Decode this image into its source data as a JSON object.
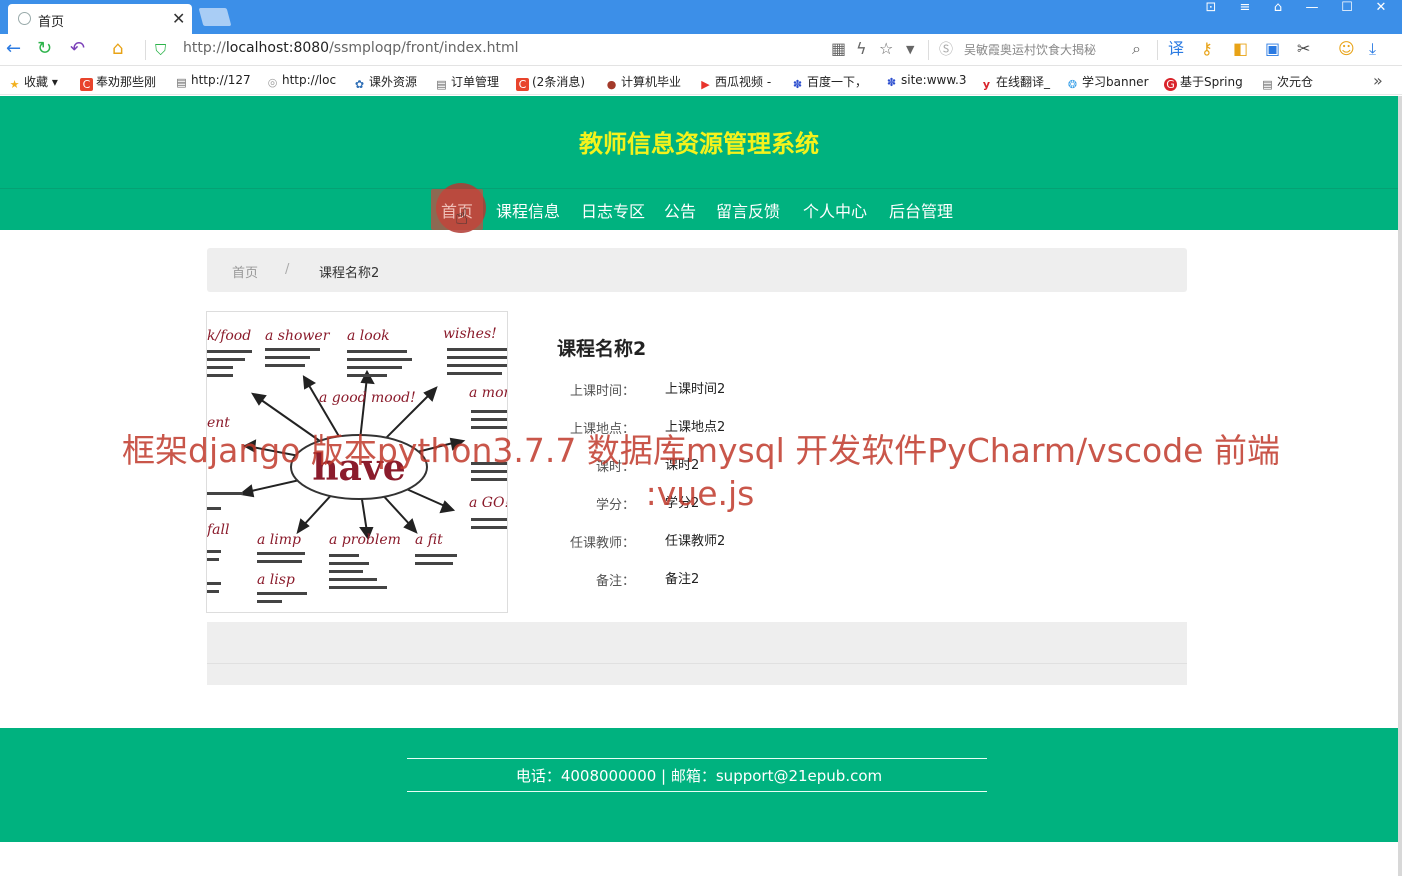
{
  "browser": {
    "tab_title": "首页",
    "url_prefix": "http://",
    "url_host": "localhost:8080",
    "url_path": "/ssmploqp/front/index.html",
    "search_hint": "吴敏霞奥运村饮食大揭秘",
    "bookmarks": [
      {
        "label": "收藏",
        "color": "#f2b01e",
        "icon": "★"
      },
      {
        "label": "奉劝那些刚",
        "color": "#e8442c",
        "icon": "C"
      },
      {
        "label": "http://127",
        "color": "#666666",
        "icon": "▤"
      },
      {
        "label": "http://loc",
        "color": "#999999",
        "icon": "◎"
      },
      {
        "label": "课外资源",
        "color": "#2d6db5",
        "icon": "✿"
      },
      {
        "label": "订单管理",
        "color": "#666666",
        "icon": "▤"
      },
      {
        "label": "(2条消息)",
        "color": "#e8442c",
        "icon": "C"
      },
      {
        "label": "计算机毕业",
        "color": "#a33a2a",
        "icon": "●"
      },
      {
        "label": "西瓜视频 -",
        "color": "#e8342c",
        "icon": "▶"
      },
      {
        "label": "百度一下，",
        "color": "#2d4fcf",
        "icon": "✽"
      },
      {
        "label": "site:www.3",
        "color": "#2d4fcf",
        "icon": "✽"
      },
      {
        "label": "在线翻译_",
        "color": "#d9242b",
        "icon": "y"
      },
      {
        "label": "学习banner",
        "color": "#3aa0e8",
        "icon": "❂"
      },
      {
        "label": "基于Spring",
        "color": "#d9242b",
        "icon": "G"
      },
      {
        "label": "次元仓",
        "color": "#666666",
        "icon": "▤"
      }
    ]
  },
  "site": {
    "title": "教师信息资源管理系统",
    "nav": [
      "首页",
      "课程信息",
      "日志专区",
      "公告",
      "留言反馈",
      "个人中心",
      "后台管理"
    ]
  },
  "breadcrumb": {
    "home": "首页",
    "separator": "/",
    "current": "课程名称2"
  },
  "image": {
    "center_word": "have",
    "phrases": [
      "k/food",
      "a shower",
      "a look",
      "wishes!",
      "a good mood!",
      "a mon",
      "ent",
      "a GO!",
      "fall",
      "a limp",
      "a problem",
      "a fit",
      "a lisp"
    ]
  },
  "course": {
    "name": "课程名称2",
    "fields": [
      {
        "label": "上课时间：",
        "value": "上课时间2"
      },
      {
        "label": "上课地点：",
        "value": "上课地点2"
      },
      {
        "label": "课时：",
        "value": "课时2"
      },
      {
        "label": "学分：",
        "value": "学分2"
      },
      {
        "label": "任课教师：",
        "value": "任课教师2"
      },
      {
        "label": "备注：",
        "value": "备注2"
      }
    ]
  },
  "watermark": {
    "line1": "框架django 版本python3.7.7 数据库mysql  开发软件PyCharm/vscode 前端",
    "line2": ":vue.js"
  },
  "footer": {
    "contact": "电话：4008000000 | 邮箱：support@21epub.com"
  }
}
